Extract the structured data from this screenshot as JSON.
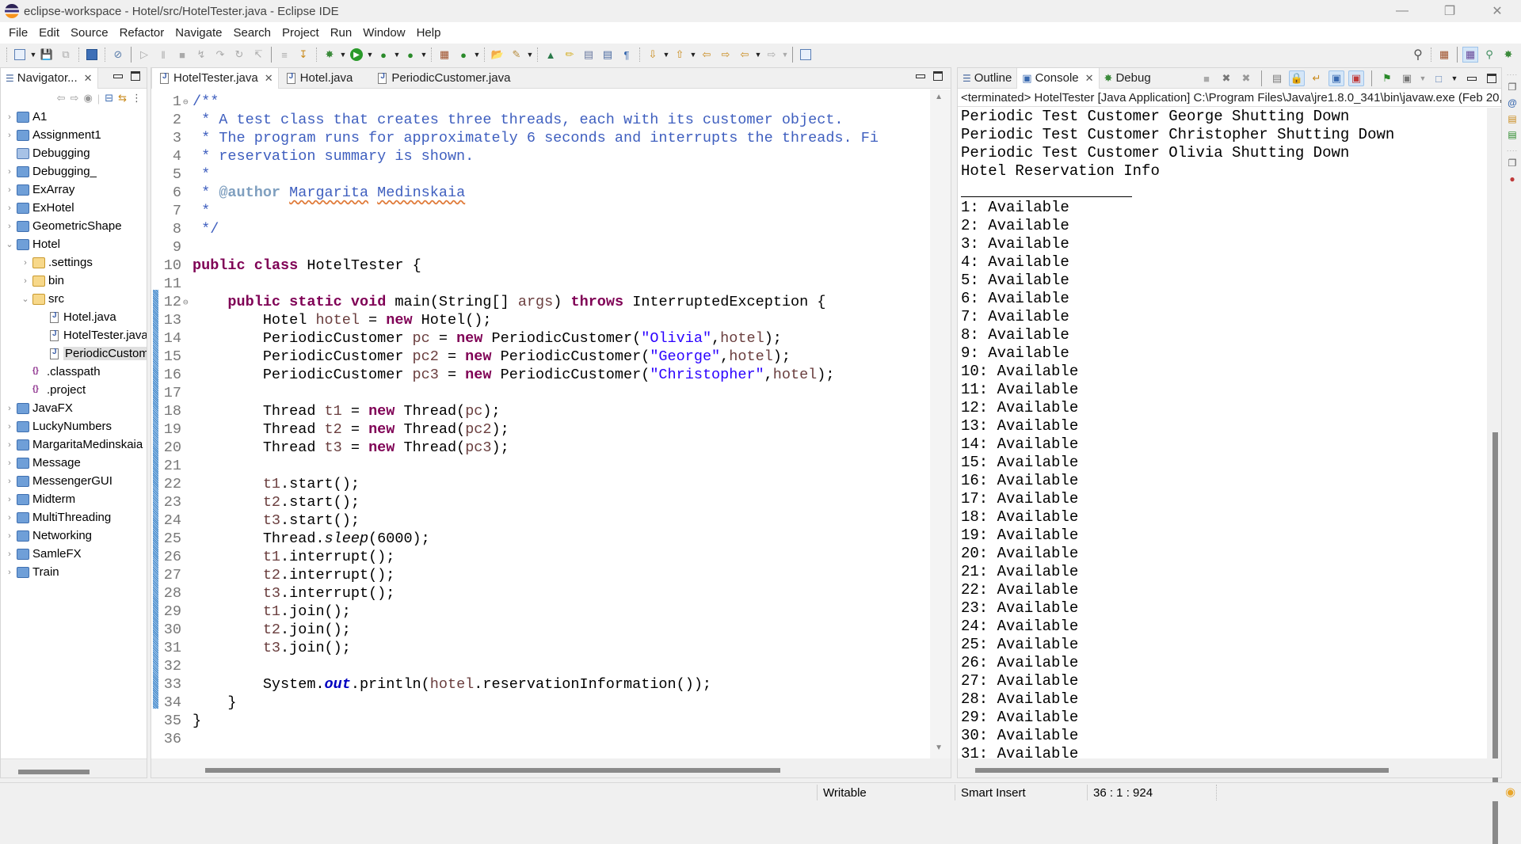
{
  "window": {
    "title": "eclipse-workspace - Hotel/src/HotelTester.java - Eclipse IDE",
    "controls": [
      "minimize",
      "restore",
      "close"
    ]
  },
  "menu": [
    "File",
    "Edit",
    "Source",
    "Refactor",
    "Navigate",
    "Search",
    "Project",
    "Run",
    "Window",
    "Help"
  ],
  "toolbar": {
    "left_icons": [
      "new-icon",
      "save-icon",
      "save-all-icon",
      "terminal-icon",
      "skip-breakpoints-icon",
      "resume-icon",
      "suspend-icon",
      "terminate-icon",
      "disconnect-icon",
      "step-into-icon",
      "step-over-icon",
      "step-return-icon",
      "drop-to-frame-icon",
      "use-step-filters-icon",
      "debug-icon",
      "run-icon",
      "coverage-icon",
      "external-tools-icon",
      "new-java-package-icon",
      "new-java-class-icon",
      "open-type-icon",
      "search-icon",
      "toggle-breadcrumb-icon",
      "toggle-mark-occurrences-icon",
      "toggle-block-selection-icon",
      "toggle-word-wrap-icon",
      "show-whitespace-icon",
      "next-annotation-icon",
      "previous-annotation-icon",
      "last-edit-location-icon",
      "back-icon",
      "forward-icon",
      "pin-editor-icon"
    ],
    "right_icons": [
      "search-icon",
      "open-perspective-icon",
      "java-perspective-icon",
      "java-browsing-perspective-icon",
      "debug-perspective-icon"
    ]
  },
  "navigator": {
    "title": "Navigator...",
    "toolbar_icons": [
      "back-icon",
      "forward-icon",
      "up-icon",
      "collapse-all-icon",
      "link-with-editor-icon",
      "view-menu-icon"
    ],
    "tree": [
      {
        "label": "A1",
        "depth": 0,
        "type": "project",
        "expanded": false
      },
      {
        "label": "Assignment1",
        "depth": 0,
        "type": "project",
        "expanded": false
      },
      {
        "label": "Debugging",
        "depth": 0,
        "type": "closed-project",
        "expanded": null
      },
      {
        "label": "Debugging_",
        "depth": 0,
        "type": "project",
        "expanded": false
      },
      {
        "label": "ExArray",
        "depth": 0,
        "type": "project",
        "expanded": false
      },
      {
        "label": "ExHotel",
        "depth": 0,
        "type": "project",
        "expanded": false
      },
      {
        "label": "GeometricShape",
        "depth": 0,
        "type": "project",
        "expanded": false
      },
      {
        "label": "Hotel",
        "depth": 0,
        "type": "project",
        "expanded": true
      },
      {
        "label": ".settings",
        "depth": 1,
        "type": "folder",
        "expanded": false
      },
      {
        "label": "bin",
        "depth": 1,
        "type": "folder",
        "expanded": false
      },
      {
        "label": "src",
        "depth": 1,
        "type": "folder",
        "expanded": true
      },
      {
        "label": "Hotel.java",
        "depth": 2,
        "type": "java",
        "expanded": null
      },
      {
        "label": "HotelTester.java",
        "depth": 2,
        "type": "java",
        "expanded": null
      },
      {
        "label": "PeriodicCustomer.java",
        "depth": 2,
        "type": "java",
        "expanded": null,
        "selected": true
      },
      {
        "label": ".classpath",
        "depth": 1,
        "type": "xml",
        "expanded": null
      },
      {
        "label": ".project",
        "depth": 1,
        "type": "xml",
        "expanded": null
      },
      {
        "label": "JavaFX",
        "depth": 0,
        "type": "project",
        "expanded": false
      },
      {
        "label": "LuckyNumbers",
        "depth": 0,
        "type": "project",
        "expanded": false
      },
      {
        "label": "MargaritaMedinskaia",
        "depth": 0,
        "type": "project",
        "expanded": false
      },
      {
        "label": "Message",
        "depth": 0,
        "type": "project",
        "expanded": false
      },
      {
        "label": "MessengerGUI",
        "depth": 0,
        "type": "project",
        "expanded": false
      },
      {
        "label": "Midterm",
        "depth": 0,
        "type": "project",
        "expanded": false
      },
      {
        "label": "MultiThreading",
        "depth": 0,
        "type": "project",
        "expanded": false
      },
      {
        "label": "Networking",
        "depth": 0,
        "type": "project",
        "expanded": false
      },
      {
        "label": "SamleFX",
        "depth": 0,
        "type": "project",
        "expanded": false
      },
      {
        "label": "Train",
        "depth": 0,
        "type": "project",
        "expanded": false
      }
    ]
  },
  "editor": {
    "tabs": [
      {
        "label": "HotelTester.java",
        "active": true,
        "closable": true
      },
      {
        "label": "Hotel.java",
        "active": false,
        "closable": false
      },
      {
        "label": "PeriodicCustomer.java",
        "active": false,
        "closable": false
      }
    ],
    "current_line": 36,
    "lines": [
      [
        [
          "c",
          "/**"
        ]
      ],
      [
        [
          "c",
          " * A test class that creates three threads, each with its customer object."
        ]
      ],
      [
        [
          "c",
          " * The program runs for approximately 6 seconds and interrupts the threads. Fi"
        ]
      ],
      [
        [
          "c",
          " * reservation summary is shown."
        ]
      ],
      [
        [
          "c",
          " *"
        ]
      ],
      [
        [
          "c",
          " * "
        ],
        [
          "ct",
          "@author"
        ],
        [
          "c",
          " "
        ],
        [
          "csp",
          "Margarita"
        ],
        [
          "c",
          " "
        ],
        [
          "csp",
          "Medinskaia"
        ]
      ],
      [
        [
          "c",
          " *"
        ]
      ],
      [
        [
          "c",
          " */"
        ]
      ],
      [],
      [
        [
          "k",
          "public"
        ],
        [
          "",
          " "
        ],
        [
          "k",
          "class"
        ],
        [
          "",
          " HotelTester {"
        ]
      ],
      [],
      [
        [
          "",
          "    "
        ],
        [
          "k",
          "public"
        ],
        [
          "",
          " "
        ],
        [
          "k",
          "static"
        ],
        [
          "",
          " "
        ],
        [
          "k",
          "void"
        ],
        [
          "",
          " main(String[] "
        ],
        [
          "v",
          "args"
        ],
        [
          "",
          ") "
        ],
        [
          "k",
          "throws"
        ],
        [
          "",
          " InterruptedException {"
        ]
      ],
      [
        [
          "",
          "        Hotel "
        ],
        [
          "v",
          "hotel"
        ],
        [
          "",
          " = "
        ],
        [
          "k",
          "new"
        ],
        [
          "",
          " Hotel();"
        ]
      ],
      [
        [
          "",
          "        PeriodicCustomer "
        ],
        [
          "v",
          "pc"
        ],
        [
          "",
          " = "
        ],
        [
          "k",
          "new"
        ],
        [
          "",
          " PeriodicCustomer("
        ],
        [
          "s",
          "\"Olivia\""
        ],
        [
          "",
          ","
        ],
        [
          "v",
          "hotel"
        ],
        [
          "",
          ");"
        ]
      ],
      [
        [
          "",
          "        PeriodicCustomer "
        ],
        [
          "v",
          "pc2"
        ],
        [
          "",
          " = "
        ],
        [
          "k",
          "new"
        ],
        [
          "",
          " PeriodicCustomer("
        ],
        [
          "s",
          "\"George\""
        ],
        [
          "",
          ","
        ],
        [
          "v",
          "hotel"
        ],
        [
          "",
          ");"
        ]
      ],
      [
        [
          "",
          "        PeriodicCustomer "
        ],
        [
          "v",
          "pc3"
        ],
        [
          "",
          " = "
        ],
        [
          "k",
          "new"
        ],
        [
          "",
          " PeriodicCustomer("
        ],
        [
          "s",
          "\"Christopher\""
        ],
        [
          "",
          ","
        ],
        [
          "v",
          "hotel"
        ],
        [
          "",
          ");"
        ]
      ],
      [],
      [
        [
          "",
          "        Thread "
        ],
        [
          "v",
          "t1"
        ],
        [
          "",
          " = "
        ],
        [
          "k",
          "new"
        ],
        [
          "",
          " Thread("
        ],
        [
          "v",
          "pc"
        ],
        [
          "",
          ");"
        ]
      ],
      [
        [
          "",
          "        Thread "
        ],
        [
          "v",
          "t2"
        ],
        [
          "",
          " = "
        ],
        [
          "k",
          "new"
        ],
        [
          "",
          " Thread("
        ],
        [
          "v",
          "pc2"
        ],
        [
          "",
          ");"
        ]
      ],
      [
        [
          "",
          "        Thread "
        ],
        [
          "v",
          "t3"
        ],
        [
          "",
          " = "
        ],
        [
          "k",
          "new"
        ],
        [
          "",
          " Thread("
        ],
        [
          "v",
          "pc3"
        ],
        [
          "",
          ");"
        ]
      ],
      [],
      [
        [
          "",
          "        "
        ],
        [
          "v",
          "t1"
        ],
        [
          "",
          ".start();"
        ]
      ],
      [
        [
          "",
          "        "
        ],
        [
          "v",
          "t2"
        ],
        [
          "",
          ".start();"
        ]
      ],
      [
        [
          "",
          "        "
        ],
        [
          "v",
          "t3"
        ],
        [
          "",
          ".start();"
        ]
      ],
      [
        [
          "",
          "        Thread."
        ],
        [
          "it",
          "sleep"
        ],
        [
          "",
          "(6000);"
        ]
      ],
      [
        [
          "",
          "        "
        ],
        [
          "v",
          "t1"
        ],
        [
          "",
          ".interrupt();"
        ]
      ],
      [
        [
          "",
          "        "
        ],
        [
          "v",
          "t2"
        ],
        [
          "",
          ".interrupt();"
        ]
      ],
      [
        [
          "",
          "        "
        ],
        [
          "v",
          "t3"
        ],
        [
          "",
          ".interrupt();"
        ]
      ],
      [
        [
          "",
          "        "
        ],
        [
          "v",
          "t1"
        ],
        [
          "",
          ".join();"
        ]
      ],
      [
        [
          "",
          "        "
        ],
        [
          "v",
          "t2"
        ],
        [
          "",
          ".join();"
        ]
      ],
      [
        [
          "",
          "        "
        ],
        [
          "v",
          "t3"
        ],
        [
          "",
          ".join();"
        ]
      ],
      [],
      [
        [
          "",
          "        System."
        ],
        [
          "f",
          "out"
        ],
        [
          "",
          ".println("
        ],
        [
          "v",
          "hotel"
        ],
        [
          "",
          ".reservationInformation());"
        ]
      ],
      [
        [
          "",
          "    }"
        ]
      ],
      [
        [
          "",
          "}"
        ]
      ],
      []
    ],
    "folding_lines": [
      1,
      12
    ]
  },
  "console": {
    "tabs": [
      {
        "label": "Outline",
        "active": false
      },
      {
        "label": "Console",
        "active": true,
        "closable": true
      },
      {
        "label": "Debug",
        "active": false
      }
    ],
    "toolbar_icons": [
      "terminate-icon",
      "remove-launch-icon",
      "remove-all-terminated-icon",
      "clear-console-icon",
      "scroll-lock-icon",
      "word-wrap-icon",
      "show-on-stdout-icon",
      "show-on-stderr-icon",
      "pin-console-icon",
      "display-console-icon",
      "open-console-icon",
      "minimize-icon",
      "maximize-icon"
    ],
    "description": "<terminated> HotelTester [Java Application] C:\\Program Files\\Java\\jre1.8.0_341\\bin\\javaw.exe  (Feb 20,",
    "output_lines": [
      "Periodic Test Customer George Shutting Down",
      "Periodic Test Customer Christopher Shutting Down",
      "Periodic Test Customer Olivia Shutting Down",
      "Hotel Reservation Info",
      "__RULE__",
      "1: Available",
      "2: Available",
      "3: Available",
      "4: Available",
      "5: Available",
      "6: Available",
      "7: Available",
      "8: Available",
      "9: Available",
      "10: Available",
      "11: Available",
      "12: Available",
      "13: Available",
      "14: Available",
      "15: Available",
      "16: Available",
      "17: Available",
      "18: Available",
      "19: Available",
      "20: Available",
      "21: Available",
      "22: Available",
      "23: Available",
      "24: Available",
      "25: Available",
      "26: Available",
      "27: Available",
      "28: Available",
      "29: Available",
      "30: Available",
      "31: Available"
    ]
  },
  "right_trim_icons": [
    "restore-icon",
    "javadoc-icon",
    "declaration-icon",
    "progress-icon",
    "restore-icon",
    "breakpoints-icon"
  ],
  "statusbar": {
    "writable": "Writable",
    "insert_mode": "Smart Insert",
    "position": "36 : 1 : 924"
  },
  "colors": {
    "keyword": "#7f0055",
    "comment": "#3f5fbf",
    "string": "#2a00ff",
    "local_var": "#6a3e3e",
    "static_field": "#0000c0",
    "current_line": "#e8f2fe"
  }
}
